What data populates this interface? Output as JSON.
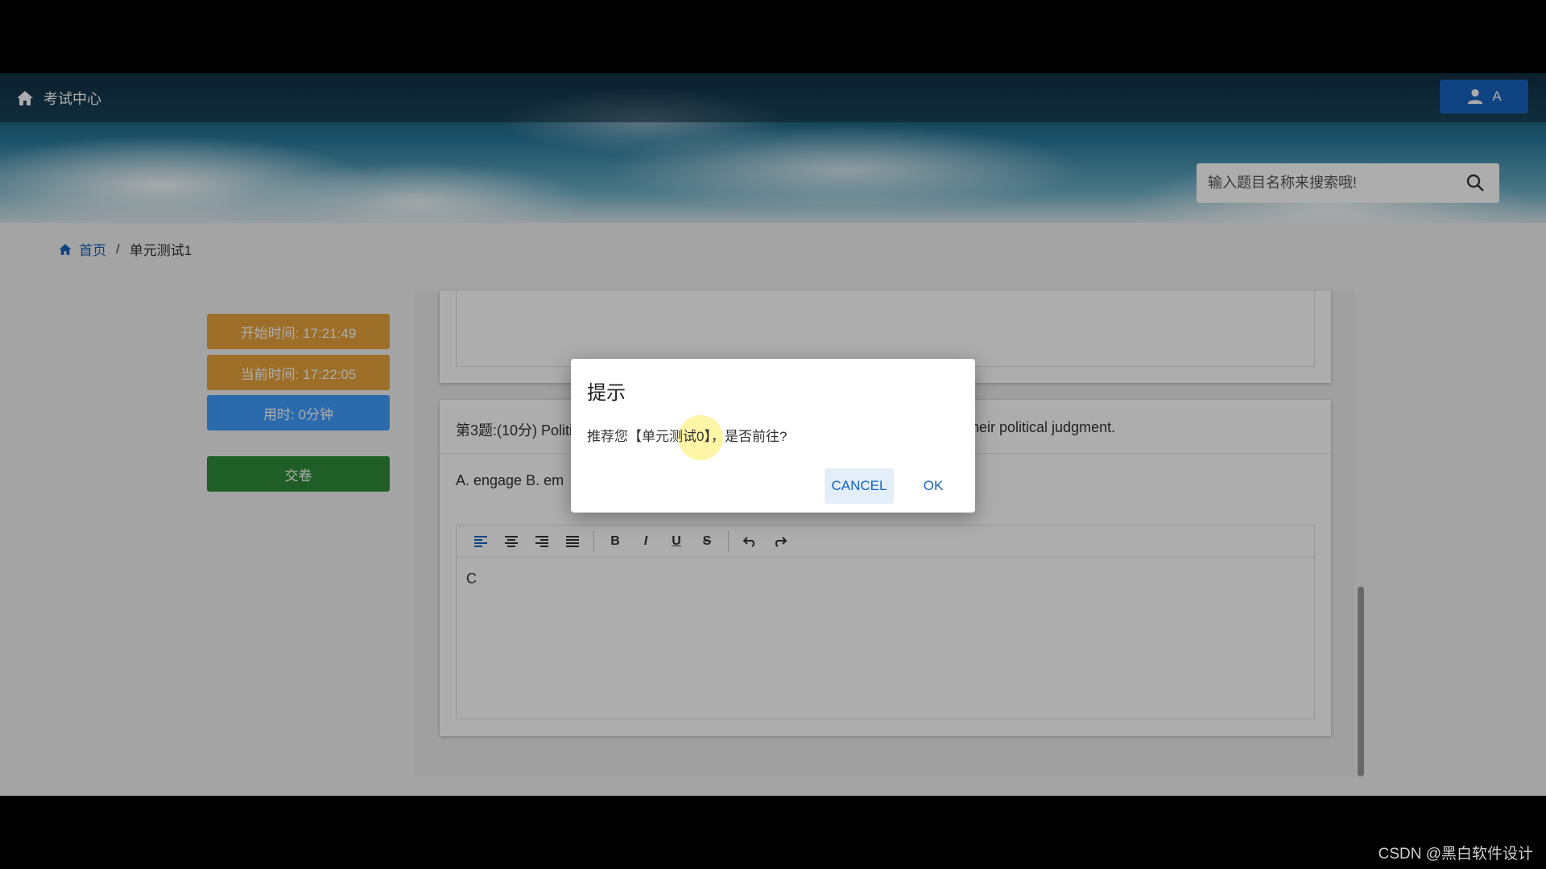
{
  "header": {
    "site_title": "考试中心",
    "user_label": "A",
    "search_placeholder": "输入题目名称来搜索哦!"
  },
  "breadcrumb": {
    "home": "首页",
    "separator": "/",
    "current": "单元测试1"
  },
  "sidebar": {
    "start_time": "开始时间: 17:21:49",
    "current_time": "当前时间: 17:22:05",
    "time_used": "用时: 0分钟",
    "submit": "交卷"
  },
  "question": {
    "title_left": "第3题:(10分) Politi",
    "title_right": "heir political judgment.",
    "options": "A. engage   B. em"
  },
  "editor": {
    "toolbar": {
      "bold": "B",
      "italic": "I",
      "underline": "U",
      "strike": "S"
    },
    "content": "C"
  },
  "dialog": {
    "title": "提示",
    "message": "推荐您【单元测试0】，是否前往?",
    "cancel": "CANCEL",
    "ok": "OK"
  },
  "watermark": "CSDN @黑白软件设计",
  "colors": {
    "primary": "#1763c0",
    "warning": "#e6a23c",
    "info": "#409eff",
    "success": "#2e8b3a"
  }
}
